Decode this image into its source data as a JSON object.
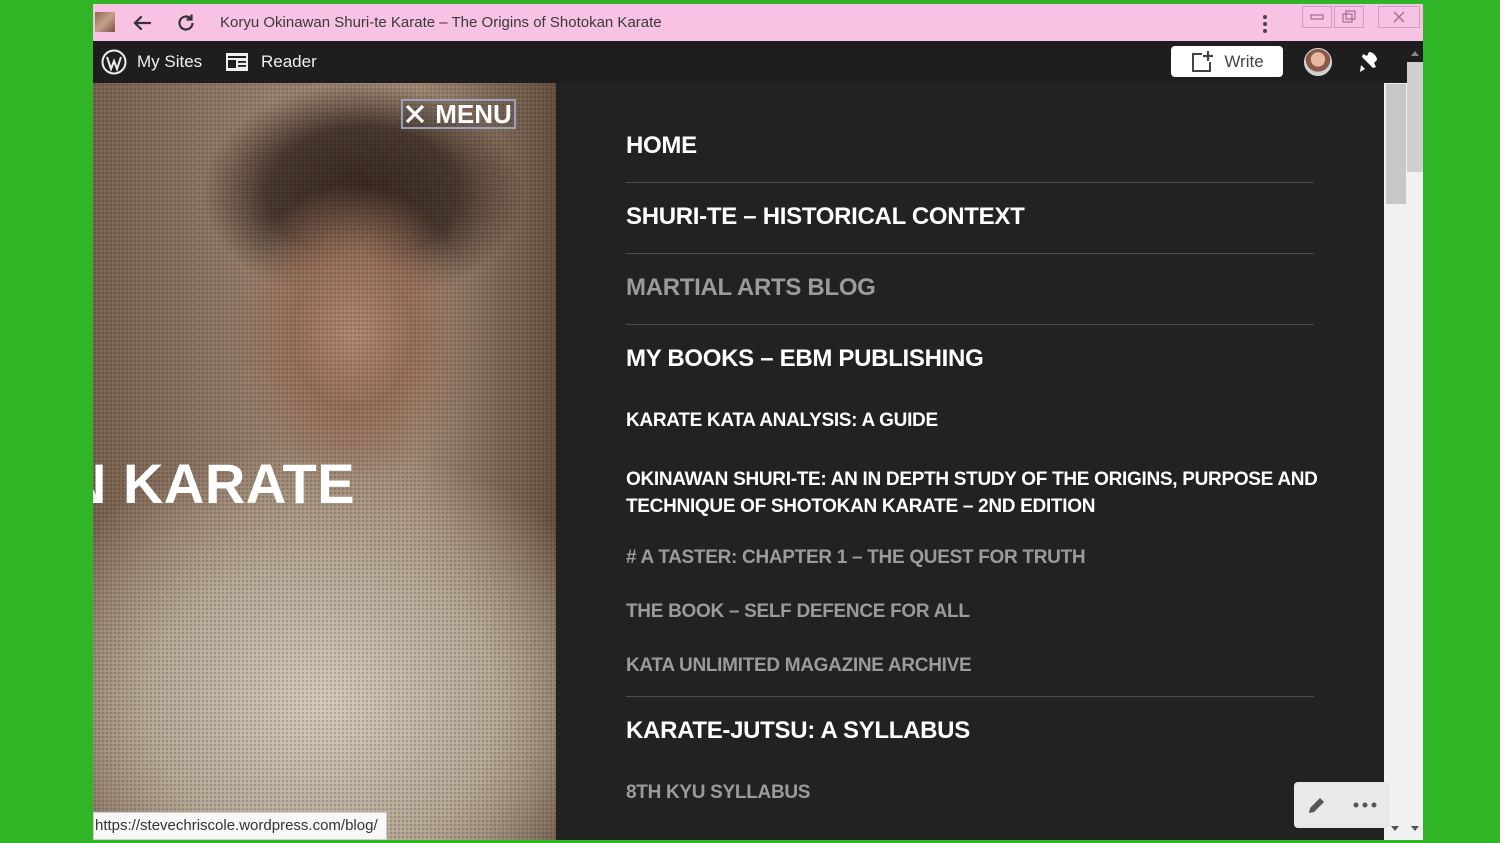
{
  "browser": {
    "page_title": "Koryu Okinawan Shuri-te Karate – The Origins of Shotokan Karate",
    "status_url": "https://stevechriscole.wordpress.com/blog/"
  },
  "adminbar": {
    "my_sites": "My Sites",
    "reader": "Reader",
    "write": "Write"
  },
  "hero": {
    "title_fragment": "AN KARATE",
    "menu_label": "MENU"
  },
  "nav": {
    "home": "HOME",
    "shuri_te": "SHURI-TE – HISTORICAL CONTEXT",
    "blog": "MARTIAL ARTS BLOG",
    "books": "MY BOOKS – EBM PUBLISHING",
    "kata_analysis": "KARATE KATA ANALYSIS: A GUIDE",
    "okinawan_line1": "OKINAWAN SHURI-TE: AN IN DEPTH STUDY OF THE ORIGINS, PURPOSE AND",
    "okinawan_line2": "TECHNIQUE OF SHOTOKAN KARATE – 2ND EDITION",
    "taster": "#  A TASTER: CHAPTER 1 – THE QUEST FOR TRUTH",
    "self_defence": "THE BOOK – SELF DEFENCE FOR ALL",
    "kata_unlimited": "KATA UNLIMITED MAGAZINE ARCHIVE",
    "karate_jutsu": "KARATE-JUTSU: A SYLLABUS",
    "kyu8": "8TH KYU SYLLABUS"
  },
  "colors": {
    "background_green": "#2fb526",
    "titlebar_pink": "#f7c2e3",
    "nav_bg": "#222222",
    "muted_link": "#9b9b9b"
  }
}
